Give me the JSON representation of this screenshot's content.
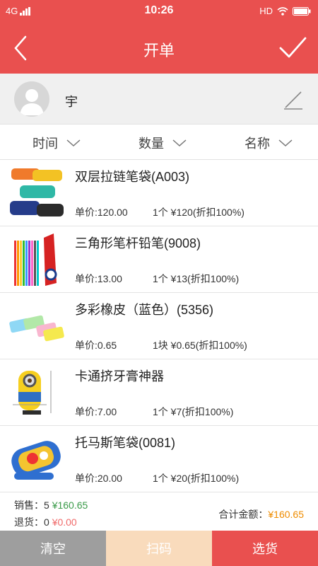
{
  "status_bar": {
    "network": "4G",
    "time": "10:26",
    "hd": "HD"
  },
  "header": {
    "title": "开单"
  },
  "customer": {
    "name": "宇"
  },
  "sort": [
    {
      "label": "时间"
    },
    {
      "label": "数量"
    },
    {
      "label": "名称"
    }
  ],
  "items": [
    {
      "name": "双层拉链笔袋(A003)",
      "price": "单价:120.00",
      "qty": "1个 ¥120(折扣100%)"
    },
    {
      "name": "三角形笔杆铅笔(9008)",
      "price": "单价:13.00",
      "qty": "1个 ¥13(折扣100%)"
    },
    {
      "name": "多彩橡皮（蓝色）(5356)",
      "price": "单价:0.65",
      "qty": "1块 ¥0.65(折扣100%)"
    },
    {
      "name": "卡通挤牙膏神器",
      "price": "单价:7.00",
      "qty": "1个 ¥7(折扣100%)"
    },
    {
      "name": "托马斯笔袋(0081)",
      "price": "单价:20.00",
      "qty": "1个 ¥20(折扣100%)"
    }
  ],
  "summary": {
    "sales_label": "销售：",
    "sales_count": "5",
    "sales_amount": "¥160.65",
    "returns_label": "退货：",
    "returns_count": "0",
    "returns_amount": "¥0.00",
    "total_label": "合计金额：",
    "total_amount": "¥160.65"
  },
  "bottom_bar": {
    "clear": "清空",
    "scan": "扫码",
    "select": "选货"
  },
  "colors": {
    "primary": "#e9504f",
    "green": "#3a9b49",
    "orange": "#ef8c00",
    "scan_bg": "#f9dbbc",
    "clear_bg": "#9e9e9e"
  }
}
